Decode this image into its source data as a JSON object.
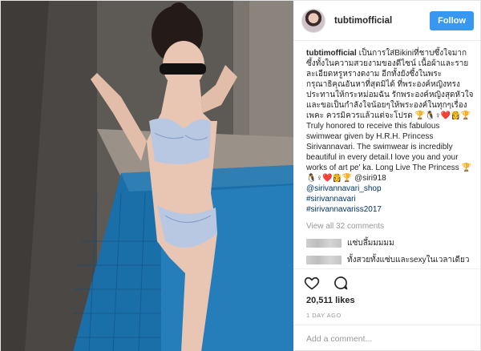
{
  "post": {
    "username": "tubtimofficial",
    "follow_label": "Follow",
    "caption": {
      "username": "tubtimofficial",
      "text": "เป็นการใส่Bikiniที่ชาบซึ้งใจมาก ซึ้งทั้งในความสวยงามของดีไซน์ เนื้อผ้าและรายละเอียดหรูหรางดงาม อีกทั้งยังซึ้งในพระกรุณาธิคุณอันหาที่สุดมิได้ ที่พระองค์หญิงทรงประทานให้กระหม่อมฉัน รักพระองค์หญิงสุดหัวใจและขอเป็นกำลังใจน้อยๆให้พระองค์ในทุกๆเรื่องเพคะ ควรมิควรแล้วแต่จะโปรด 🏆🐧♀❤️👸🏆 Truly honored to receive this fabulous swimwear given by H.R.H. Princess Sirivannavari. The swimwear is incredibly beautiful in every detail.I love you and your works of art pe' ka. Long Live The Princess 🏆🐧♀❤️👸🏆 @siri918"
    },
    "links": [
      "@sirivannavari_shop",
      "#sirivannavari",
      "#sirivannavariss2017"
    ],
    "view_all": "View all 32 comments",
    "comments": [
      {
        "text": "แซ่บลึ้มมมมม"
      },
      {
        "text": "ทั้งสวยทั้งแซ่บและsexyในเวลาเดียว"
      }
    ],
    "likes": "20,511 likes",
    "time_ago": "1 DAY AGO",
    "add_comment_placeholder": "Add a comment..."
  },
  "icons": [
    "heart-icon",
    "comment-icon"
  ],
  "colors": {
    "follow_button": "#3897f0",
    "link": "#003569",
    "muted": "#999999"
  }
}
